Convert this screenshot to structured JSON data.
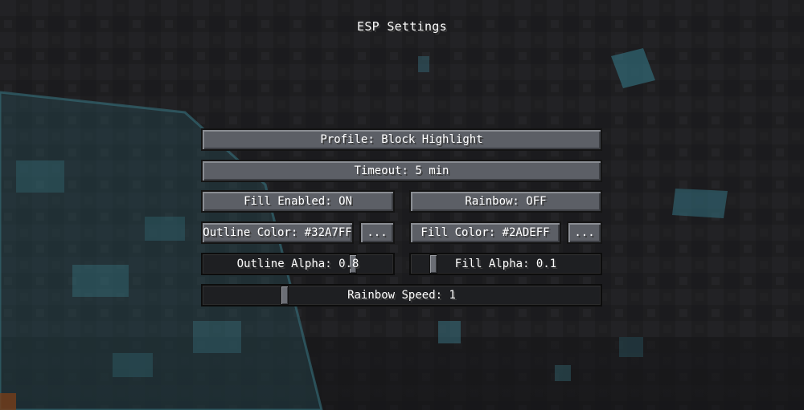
{
  "screen": {
    "title": "ESP Settings"
  },
  "buttons": {
    "profile": "Profile: Block Highlight",
    "timeout": "Timeout: 5 min",
    "fill_enabled": "Fill Enabled: ON",
    "rainbow": "Rainbow: OFF",
    "outline_color": "Outline Color: #32A7FF",
    "outline_color_picker": "...",
    "fill_color": "Fill Color: #2ADEFF",
    "fill_color_picker": "..."
  },
  "sliders": {
    "outline_alpha": {
      "label": "Outline Alpha: 0.8",
      "value": 0.8
    },
    "fill_alpha": {
      "label": "Fill Alpha: 0.1",
      "value": 0.1
    },
    "rainbow_speed": {
      "label": "Rainbow Speed: 1",
      "value": 0.2
    }
  },
  "colors": {
    "outline": "#32A7FF",
    "fill": "#2ADEFF"
  }
}
